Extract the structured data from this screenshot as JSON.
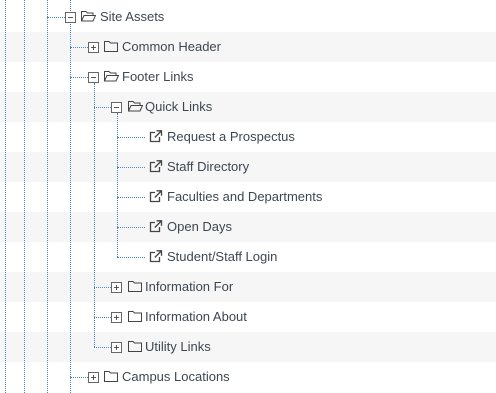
{
  "tree": {
    "rows": [
      {
        "label": "Site Assets",
        "level": 0,
        "expanded": true,
        "icon": "folder-open-icon",
        "toggle": "minus"
      },
      {
        "label": "Common Header",
        "level": 1,
        "expanded": false,
        "icon": "folder-icon",
        "toggle": "plus"
      },
      {
        "label": "Footer Links",
        "level": 1,
        "expanded": true,
        "icon": "folder-open-icon",
        "toggle": "minus"
      },
      {
        "label": "Quick Links",
        "level": 2,
        "expanded": true,
        "icon": "folder-open-icon",
        "toggle": "minus"
      },
      {
        "label": "Request a Prospectus",
        "level": 3,
        "icon": "external-link-icon"
      },
      {
        "label": "Staff Directory",
        "level": 3,
        "icon": "external-link-icon"
      },
      {
        "label": "Faculties and Departments",
        "level": 3,
        "icon": "external-link-icon"
      },
      {
        "label": "Open Days",
        "level": 3,
        "icon": "external-link-icon"
      },
      {
        "label": "Student/Staff Login",
        "level": 3,
        "icon": "external-link-icon"
      },
      {
        "label": "Information For",
        "level": 2,
        "expanded": false,
        "icon": "folder-icon",
        "toggle": "plus"
      },
      {
        "label": "Information About",
        "level": 2,
        "expanded": false,
        "icon": "folder-icon",
        "toggle": "plus"
      },
      {
        "label": "Utility Links",
        "level": 2,
        "expanded": false,
        "icon": "folder-icon",
        "toggle": "plus"
      },
      {
        "label": "Campus Locations",
        "level": 1,
        "expanded": false,
        "icon": "folder-icon",
        "toggle": "plus"
      }
    ]
  },
  "colors": {
    "connector": "#4a86c6",
    "row_alt": "#f6f6f6",
    "text": "#3d4752"
  }
}
